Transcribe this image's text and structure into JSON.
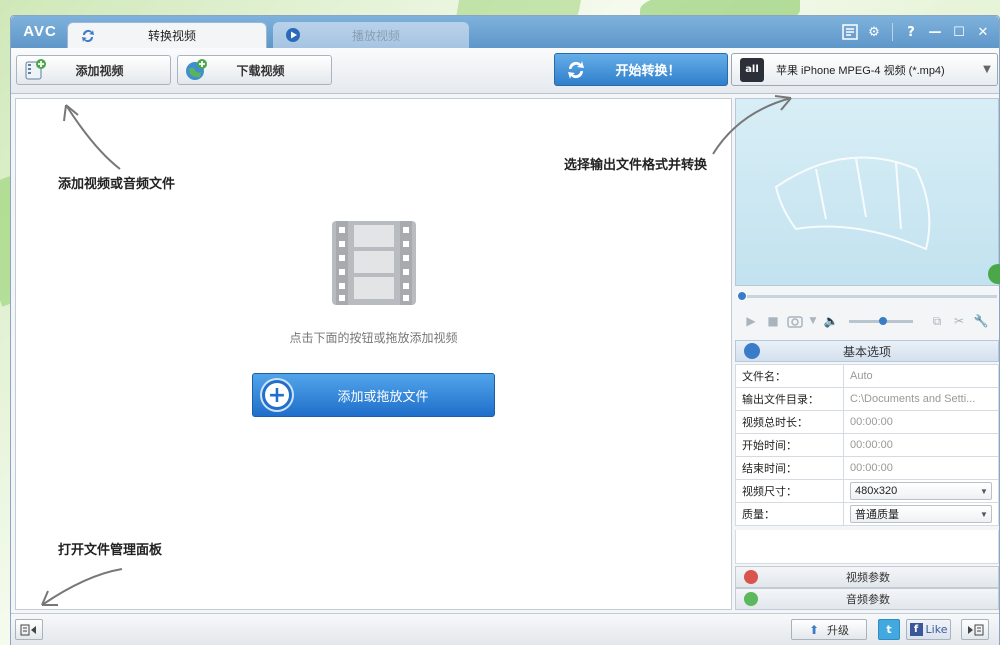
{
  "app": {
    "logo": "AVC",
    "tabs": [
      {
        "label": "转换视频",
        "active": true
      },
      {
        "label": "播放视频",
        "active": false
      }
    ],
    "window_controls": {
      "help": "?",
      "minimize": "—",
      "maximize": "☐",
      "close": "✕"
    }
  },
  "toolbar": {
    "add_video": "添加视频",
    "download_video": "下载视频",
    "start_convert": "开始转换！",
    "format_icon": "all",
    "output_format": "苹果 iPhone MPEG-4 视频 (*.mp4)"
  },
  "main": {
    "hint": "点击下面的按钮或拖放添加视频",
    "add_drop_button": "添加或拖放文件"
  },
  "annotations": {
    "add_files": "添加视频或音频文件",
    "select_format": "选择输出文件格式并转换",
    "open_panel": "打开文件管理面板"
  },
  "options": {
    "header": "基本选项",
    "rows": [
      {
        "key": "文件名：",
        "value": "Auto"
      },
      {
        "key": "输出文件目录：",
        "value": "C:\\Documents and Setti..."
      },
      {
        "key": "视频总时长：",
        "value": "00:00:00"
      },
      {
        "key": "开始时间：",
        "value": "00:00:00"
      },
      {
        "key": "结束时间：",
        "value": "00:00:00"
      },
      {
        "key": "视频尺寸：",
        "value": "480x320"
      },
      {
        "key": "质量：",
        "value": "普通质量"
      }
    ],
    "video_params": "视频参数",
    "audio_params": "音频参数"
  },
  "status": {
    "upgrade": "升级",
    "twitter": "t",
    "facebook_f": "f",
    "like": "Like"
  },
  "colors": {
    "accent": "#2f7fcb",
    "title_bar": "#5f97c9",
    "facebook": "#3b5998",
    "twitter": "#41a9df"
  }
}
